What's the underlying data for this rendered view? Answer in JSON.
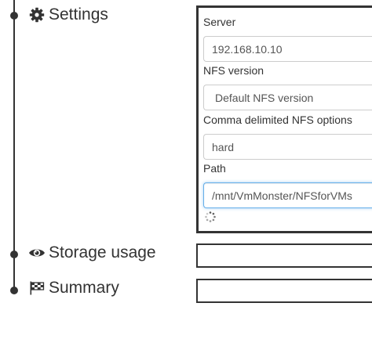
{
  "steps": [
    {
      "title": "Settings",
      "icon": "gear-icon"
    },
    {
      "title": "Storage usage",
      "icon": "eye-icon"
    },
    {
      "title": "Summary",
      "icon": "flag-checkered-icon"
    }
  ],
  "form": {
    "server": {
      "label": "Server",
      "value": "192.168.10.10"
    },
    "nfs_version": {
      "label": "NFS version",
      "selected": "Default NFS version"
    },
    "nfs_options": {
      "label": "Comma delimited NFS options",
      "value": "hard"
    },
    "path": {
      "label": "Path",
      "value": "/mnt/VmMonster/NFSforVMs"
    }
  },
  "loading_indicator": "spinner-icon",
  "colors": {
    "text": "#333333",
    "border": "#333333",
    "input_border": "#cccccc",
    "focus_border": "#66afe9"
  }
}
